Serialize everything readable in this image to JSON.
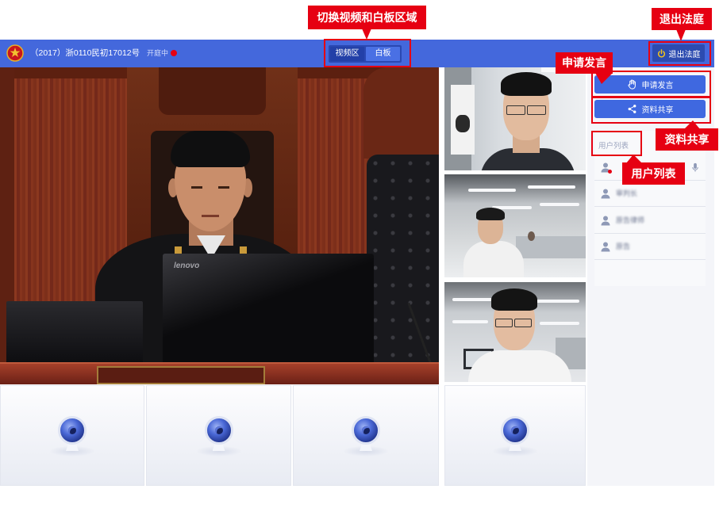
{
  "header": {
    "emblem_icon": "court-emblem-icon",
    "case_number": "（2017）浙0110民初17012号",
    "status": "开庭中",
    "status_dot_color": "#e60012",
    "tabs": [
      {
        "label": "视频区",
        "active": true
      },
      {
        "label": "白板",
        "active": false
      }
    ],
    "exit_button": {
      "label": "退出法庭",
      "icon": "power-icon"
    }
  },
  "main_video": {
    "monitor_logo": "lenovo"
  },
  "video_placeholders": {
    "icon": "webcam-icon"
  },
  "sidebar": {
    "apply_speak_button": {
      "label": "申请发言",
      "icon": "raise-hand-icon"
    },
    "share_button": {
      "label": "资料共享",
      "icon": "share-icon"
    },
    "user_list_title": "用户列表",
    "users": [
      {
        "status_dot": true,
        "mic": true
      },
      {
        "name": "审判长"
      },
      {
        "name": "原告律师"
      },
      {
        "name": "原告"
      }
    ]
  },
  "annotations": {
    "switch_area": "切换视频和白板区域",
    "exit_court": "退出法庭",
    "apply_speak": "申请发言",
    "share_files": "资料共享",
    "user_list": "用户列表"
  },
  "colors": {
    "header_blue": "#4468dc",
    "button_blue": "#3f68e0",
    "exit_button_bg": "#2c4bb0",
    "power_icon": "#f5c518",
    "annotation_red": "#e60012",
    "sidebar_bg": "#f4f5f9"
  }
}
